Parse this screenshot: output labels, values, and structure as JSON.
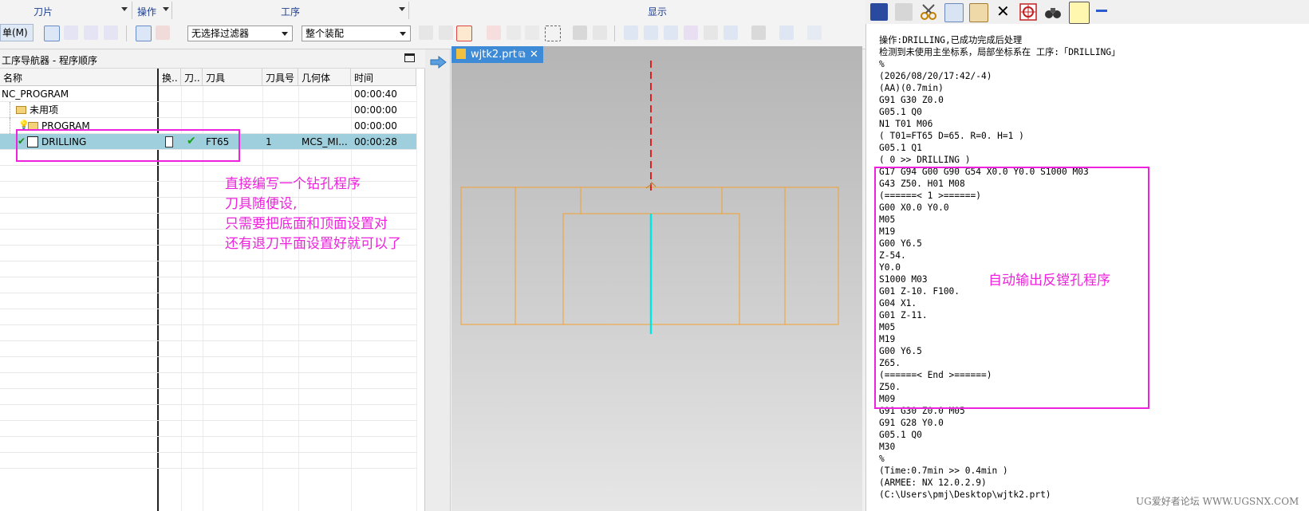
{
  "ribbon": {
    "groups": [
      "刀片",
      "操作",
      "工序",
      "显示"
    ],
    "menu_button": "单(M)",
    "filter_combo": "无选择过滤器",
    "assembly_combo": "整个装配"
  },
  "navigator": {
    "title": "工序导航器 - 程序顺序",
    "columns": [
      "名称",
      "换..",
      "刀..",
      "刀具",
      "刀具号",
      "几何体",
      "时间"
    ],
    "rows": [
      {
        "name": "NC_PROGRAM",
        "tool": "",
        "tool_no": "",
        "geometry": "",
        "time": "00:00:40"
      },
      {
        "name": "未用项",
        "tool": "",
        "tool_no": "",
        "geometry": "",
        "time": "00:00:00"
      },
      {
        "name": "PROGRAM",
        "tool": "",
        "tool_no": "",
        "geometry": "",
        "time": "00:00:00"
      },
      {
        "name": "DRILLING",
        "tool": "FT65",
        "tool_no": "1",
        "geometry": "MCS_MI...",
        "time": "00:00:28"
      }
    ]
  },
  "viewport": {
    "tab_label": "wjtk2.prt"
  },
  "annotations": {
    "left_note": [
      "直接编写一个钻孔程序",
      "刀具随便设,",
      "只需要把底面和顶面设置对",
      "还有退刀平面设置好就可以了"
    ],
    "right_note": "自动输出反镗孔程序"
  },
  "output": {
    "lines": [
      "操作:DRILLING,已成功完成后处理",
      "检测到未使用主坐标系，局部坐标系在 工序:「DRILLING」",
      "%",
      "(2026/08/20/17:42/-4)",
      "(AA)(0.7min)",
      "G91 G30 Z0.0",
      "G05.1 Q0",
      "N1 T01 M06",
      "( T01=FT65 D=65. R=0. H=1 )",
      "G05.1 Q1",
      "( 0 >> DRILLING )",
      "G17 G94 G00 G90 G54 X0.0 Y0.0 S1000 M03",
      "G43 Z50. H01 M08",
      "(======< 1 >======)",
      "G00 X0.0 Y0.0",
      "M05",
      "M19",
      "G00 Y6.5",
      "Z-54.",
      "Y0.0",
      "S1000 M03",
      "G01 Z-10. F100.",
      "G04 X1.",
      "G01 Z-11.",
      "M05",
      "M19",
      "G00 Y6.5",
      "Z65.",
      "(======< End >======)",
      "Z50.",
      "M09",
      "G91 G30 Z0.0 M05",
      "G91 G28 Y0.0",
      "G05.1 Q0",
      "M30",
      "%",
      "(Time:0.7min >> 0.4min )",
      "(ARMEE: NX 12.0.2.9)",
      "(C:\\Users\\pmj\\Desktop\\wjtk2.prt)"
    ]
  },
  "watermark": "UG爱好者论坛 WWW.UGSNX.COM",
  "colors": {
    "highlight": "#ee22dd",
    "selected_row": "#9fcfdc",
    "tab": "#3d8ad6",
    "part": "#f0a030",
    "tool_axis": "#00e5e5",
    "centerline": "#e02020"
  }
}
